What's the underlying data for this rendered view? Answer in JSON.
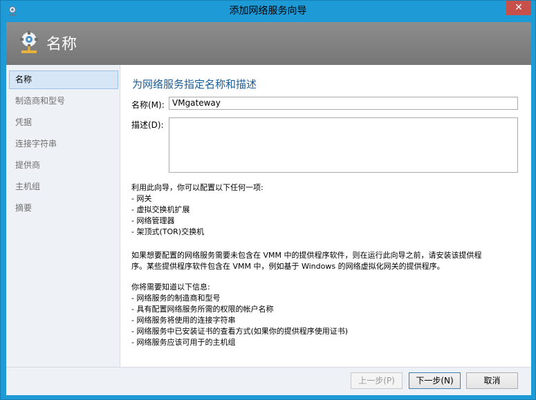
{
  "window": {
    "title": "添加网络服务向导",
    "close_label": "✕"
  },
  "header": {
    "title": "名称"
  },
  "sidebar": {
    "items": [
      {
        "label": "名称"
      },
      {
        "label": "制造商和型号"
      },
      {
        "label": "凭据"
      },
      {
        "label": "连接字符串"
      },
      {
        "label": "提供商"
      },
      {
        "label": "主机组"
      },
      {
        "label": "摘要"
      }
    ],
    "selected": "名称"
  },
  "main": {
    "heading": "为网络服务指定名称和描述",
    "name_label": "名称(M):",
    "name_value": "VMgateway",
    "desc_label": "描述(D):",
    "desc_value": "",
    "intro": {
      "line1": "利用此向导，你可以配置以下任何一项:",
      "items": [
        "- 网关",
        "- 虚拟交换机扩展",
        "- 网络管理器",
        "- 架顶式(TOR)交换机"
      ]
    },
    "note": {
      "line1": "如果想要配置的网络服务需要未包含在 VMM 中的提供程序软件，则在运行此向导之前，请安装该提供程",
      "line2": "序。某些提供程序软件包含在 VMM 中，例如基于 Windows 的网络虚拟化网关的提供程序。"
    },
    "requirements": {
      "line1": "你将需要知道以下信息:",
      "items": [
        "- 网络服务的制造商和型号",
        "- 具有配置网络服务所需的权限的帐户名称",
        "- 网络服务将使用的连接字符串",
        "- 网络服务中已安装证书的查看方式(如果你的提供程序使用证书)",
        "- 网络服务应该可用于的主机组"
      ]
    }
  },
  "footer": {
    "prev_label": "上一步(P)",
    "next_label": "下一步(N)",
    "cancel_label": "取消"
  }
}
